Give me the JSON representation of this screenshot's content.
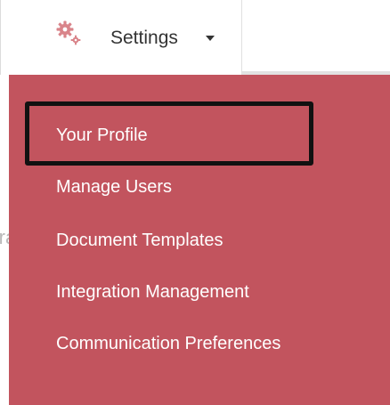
{
  "navbar": {
    "settings_label": "Settings",
    "settings_icon": "gear-icon",
    "caret_icon": "caret-down-icon"
  },
  "background_text": "Bran",
  "dropdown": {
    "items": [
      {
        "label": "Your Profile"
      },
      {
        "label": "Manage Users"
      },
      {
        "label": "Document Templates"
      },
      {
        "label": "Integration Management"
      },
      {
        "label": "Communication Preferences"
      }
    ]
  },
  "colors": {
    "menu_background": "#c2545e",
    "menu_text": "#ffffff",
    "gear_icon": "#d9848a",
    "highlight_border": "#111111"
  }
}
